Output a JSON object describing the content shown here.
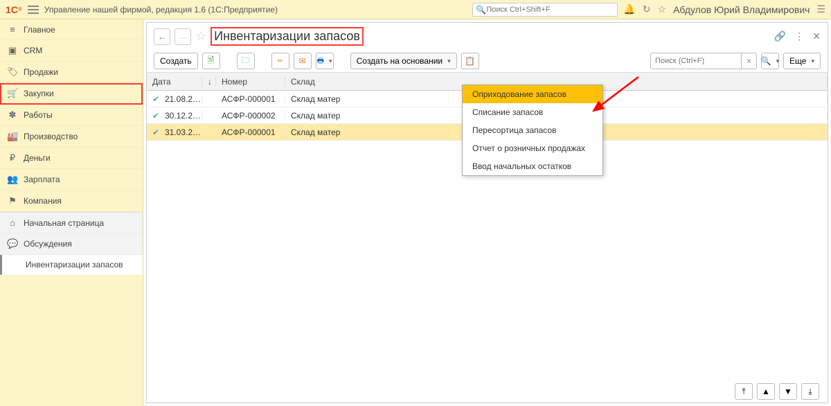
{
  "topbar": {
    "logo_text": "1C",
    "app_title": "Управление нашей фирмой, редакция 1.6   (1С:Предприятие)",
    "global_search_placeholder": "Поиск Ctrl+Shift+F",
    "username": "Абдулов Юрий Владимирович"
  },
  "sidebar": {
    "items": [
      {
        "icon": "≡",
        "label": "Главное"
      },
      {
        "icon": "▣",
        "label": "CRM"
      },
      {
        "icon": "🏷",
        "label": "Продажи"
      },
      {
        "icon": "🛒",
        "label": "Закупки"
      },
      {
        "icon": "✽",
        "label": "Работы"
      },
      {
        "icon": "🏭",
        "label": "Производство"
      },
      {
        "icon": "₽",
        "label": "Деньги"
      },
      {
        "icon": "👥",
        "label": "Зарплата"
      },
      {
        "icon": "⚑",
        "label": "Компания"
      }
    ],
    "secondary": [
      {
        "icon": "⌂",
        "label": "Начальная страница"
      },
      {
        "icon": "💬",
        "label": "Обсуждения"
      },
      {
        "icon": "",
        "label": "Инвентаризации запасов"
      }
    ]
  },
  "page": {
    "title": "Инвентаризации запасов"
  },
  "toolbar": {
    "create_label": "Создать",
    "create_based_label": "Создать на основании",
    "search_placeholder": "Поиск (Ctrl+F)",
    "more_label": "Еще"
  },
  "grid": {
    "headers": {
      "date": "Дата",
      "number": "Номер",
      "warehouse": "Склад"
    },
    "rows": [
      {
        "date": "21.08.2…",
        "number": "АСФР-000001",
        "warehouse": "Склад матер"
      },
      {
        "date": "30.12.2…",
        "number": "АСФР-000002",
        "warehouse": "Склад матер"
      },
      {
        "date": "31.03.2…",
        "number": "АСФР-000001",
        "warehouse": "Склад матер"
      }
    ]
  },
  "dropdown": {
    "items": [
      "Оприходование запасов",
      "Списание запасов",
      "Пересортица запасов",
      "Отчет о розничных продажах",
      "Ввод начальных остатков"
    ]
  }
}
